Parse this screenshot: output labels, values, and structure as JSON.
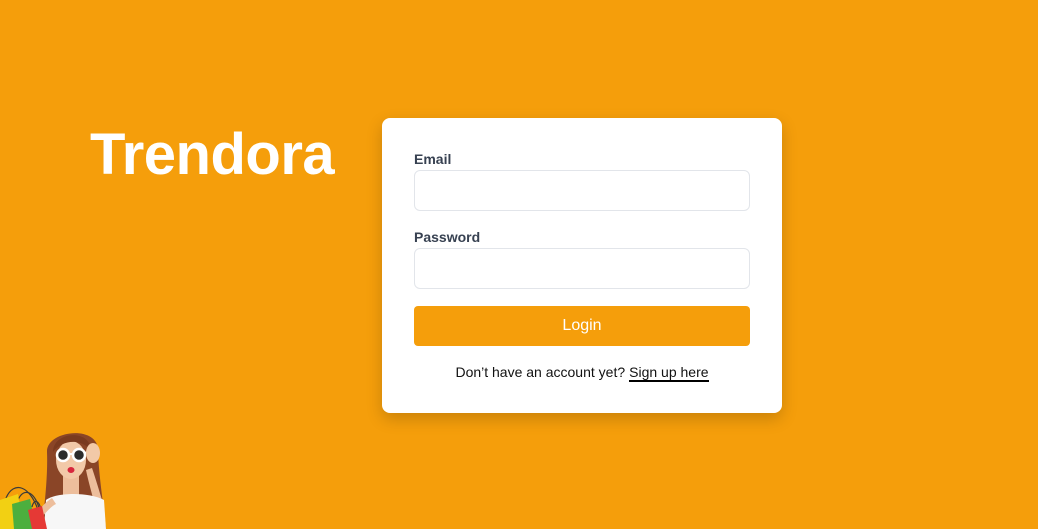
{
  "brand": {
    "name": "Trendora"
  },
  "login_form": {
    "email": {
      "label": "Email",
      "value": ""
    },
    "password": {
      "label": "Password",
      "value": ""
    },
    "submit_label": "Login",
    "signup_prompt": "Don’t have an account yet?",
    "signup_link_label": "Sign up here"
  },
  "hero_image": {
    "icon": "woman-with-shopping-bags"
  },
  "colors": {
    "background": "#F59E0B",
    "card": "#FFFFFF",
    "accent": "#F59E0B",
    "button_text": "#FFFFFF",
    "label_text": "#374151"
  }
}
